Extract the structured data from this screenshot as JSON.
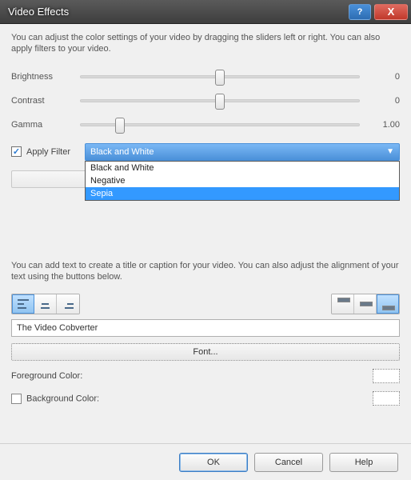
{
  "window": {
    "title": "Video Effects"
  },
  "desc1": "You can adjust the color settings of your video by dragging the sliders left or right. You can also apply filters to your video.",
  "sliders": {
    "brightness": {
      "label": "Brightness",
      "value": "0",
      "pos": 50
    },
    "contrast": {
      "label": "Contrast",
      "value": "0",
      "pos": 50
    },
    "gamma": {
      "label": "Gamma",
      "value": "1.00",
      "pos": 14
    }
  },
  "applyFilter": {
    "label": "Apply Filter",
    "checked": true,
    "selected": "Black and White",
    "options": [
      "Black and White",
      "Negative",
      "Sepia"
    ],
    "hoverIndex": 2
  },
  "desc2": "You can add text to create a title or caption for your video. You can also adjust the alignment of your text using the buttons below.",
  "caption": {
    "value": "The Video Cobverter"
  },
  "fontBtn": "Font...",
  "fgLabel": "Foreground Color:",
  "bgLabel": "Background Color:",
  "buttons": {
    "ok": "OK",
    "cancel": "Cancel",
    "help": "Help"
  }
}
